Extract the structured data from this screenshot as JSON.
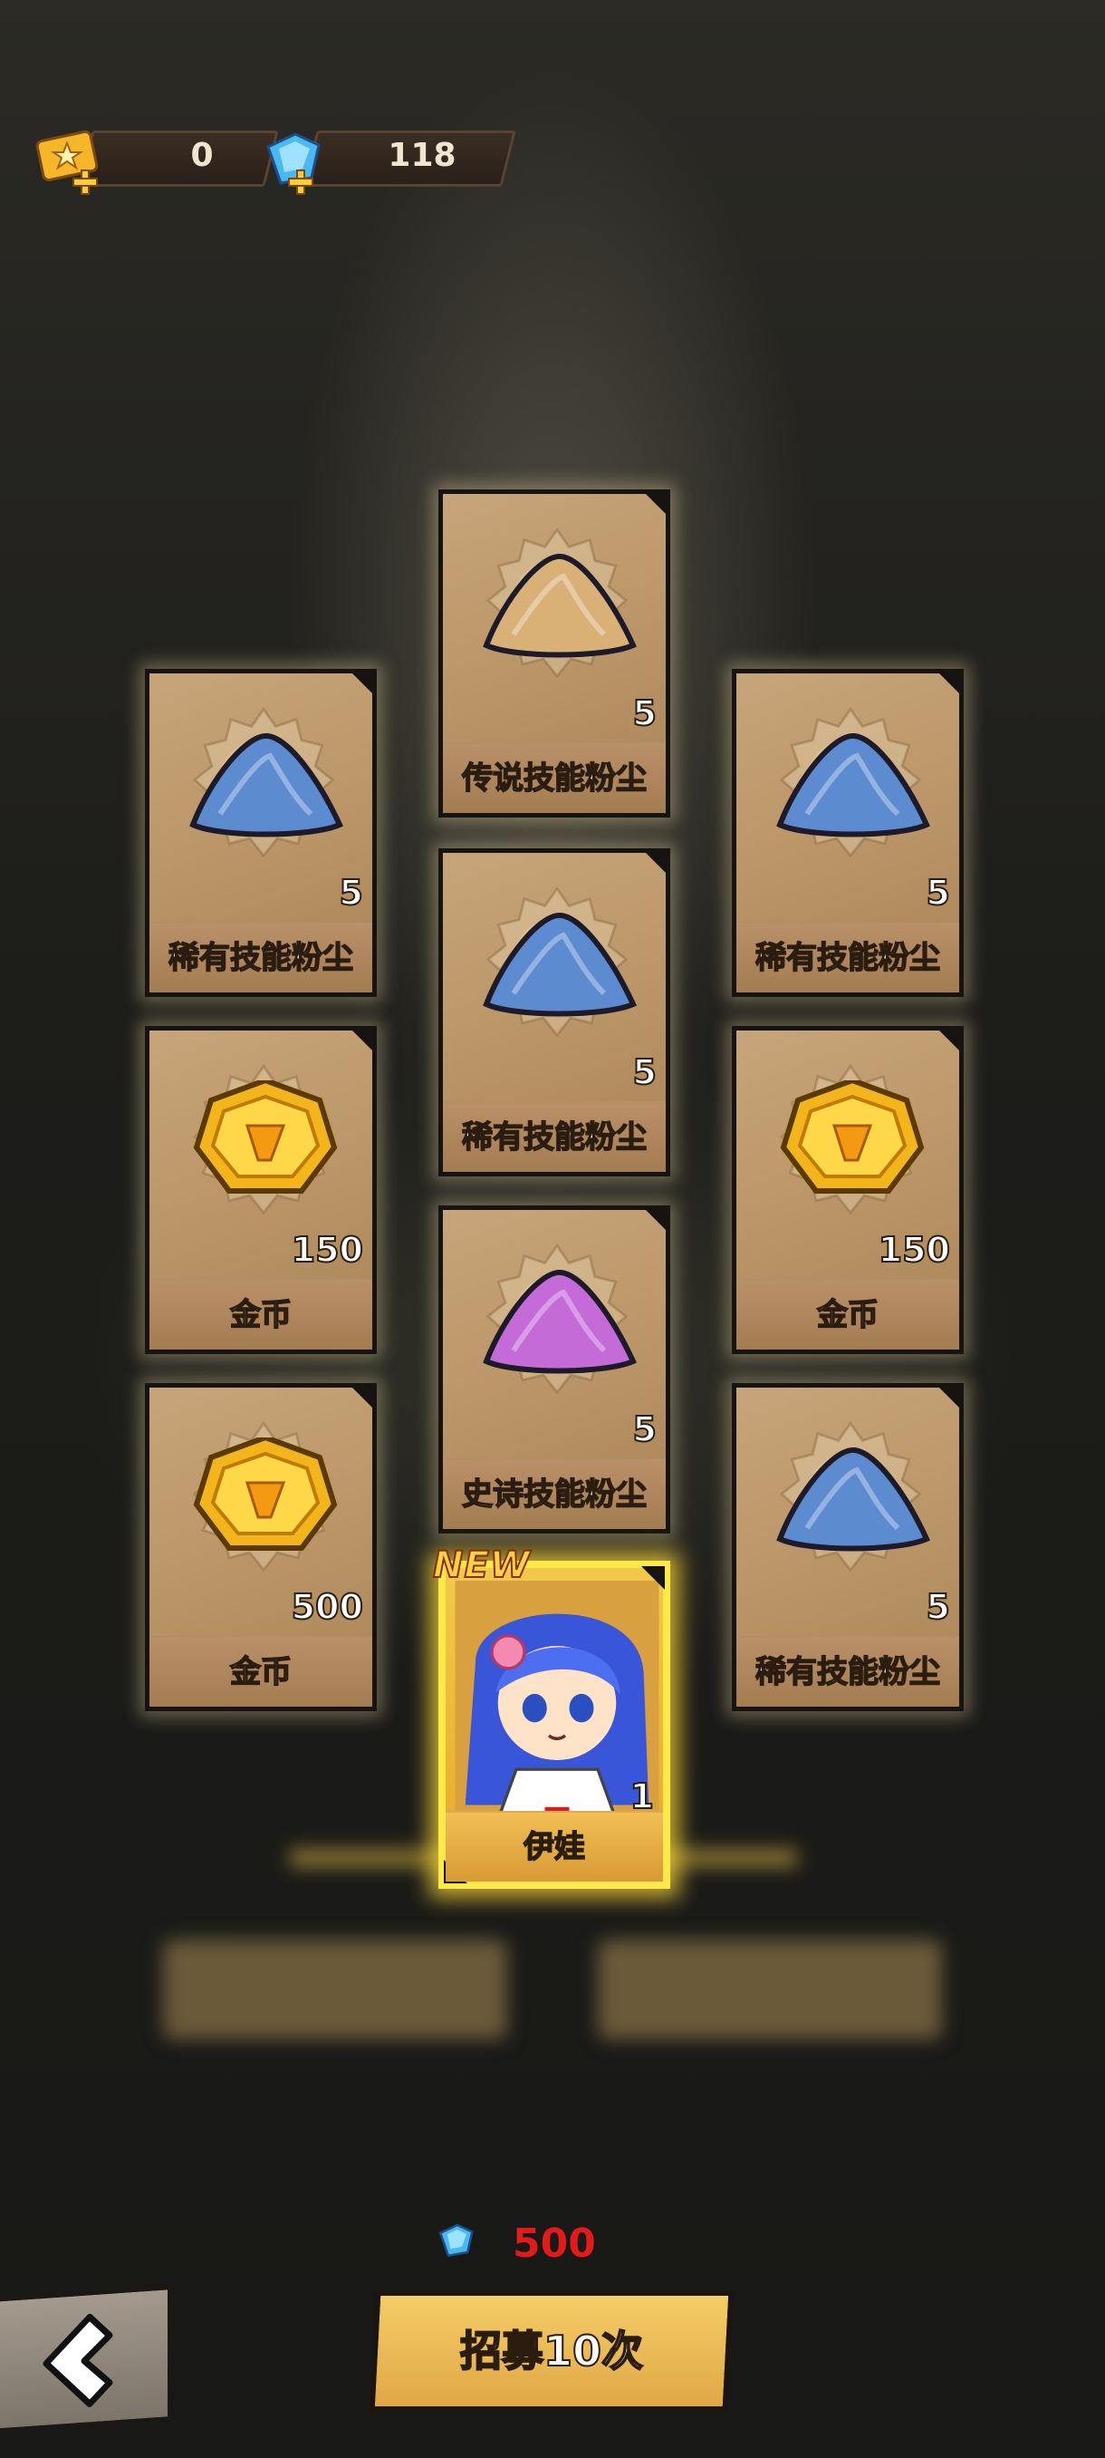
{
  "currencies": [
    {
      "name": "ticket",
      "value": "0"
    },
    {
      "name": "diamond",
      "value": "118"
    }
  ],
  "rewards": [
    {
      "label": "传说技能粉尘",
      "count": "5",
      "type": "legendary-dust",
      "color": "#d9b177"
    },
    {
      "label": "稀有技能粉尘",
      "count": "5",
      "type": "rare-dust",
      "color": "#5d8bd0"
    },
    {
      "label": "稀有技能粉尘",
      "count": "5",
      "type": "rare-dust",
      "color": "#5d8bd0"
    },
    {
      "label": "稀有技能粉尘",
      "count": "5",
      "type": "rare-dust",
      "color": "#5d8bd0"
    },
    {
      "label": "金币",
      "count": "150",
      "type": "gold-coin",
      "color": "#f2b51b"
    },
    {
      "label": "金币",
      "count": "150",
      "type": "gold-coin",
      "color": "#f2b51b"
    },
    {
      "label": "史诗技能粉尘",
      "count": "5",
      "type": "epic-dust",
      "color": "#c46bd8"
    },
    {
      "label": "金币",
      "count": "500",
      "type": "gold-coin",
      "color": "#f2b51b"
    },
    {
      "label": "稀有技能粉尘",
      "count": "5",
      "type": "rare-dust",
      "color": "#5d8bd0"
    },
    {
      "label": "伊娃",
      "count": "1",
      "type": "hero",
      "new_tag": "NEW"
    }
  ],
  "cost": {
    "value": "500",
    "icon": "diamond-icon"
  },
  "recruit_button": {
    "label": "招募10次"
  },
  "back_button": {
    "icon": "back-arrow-icon"
  }
}
